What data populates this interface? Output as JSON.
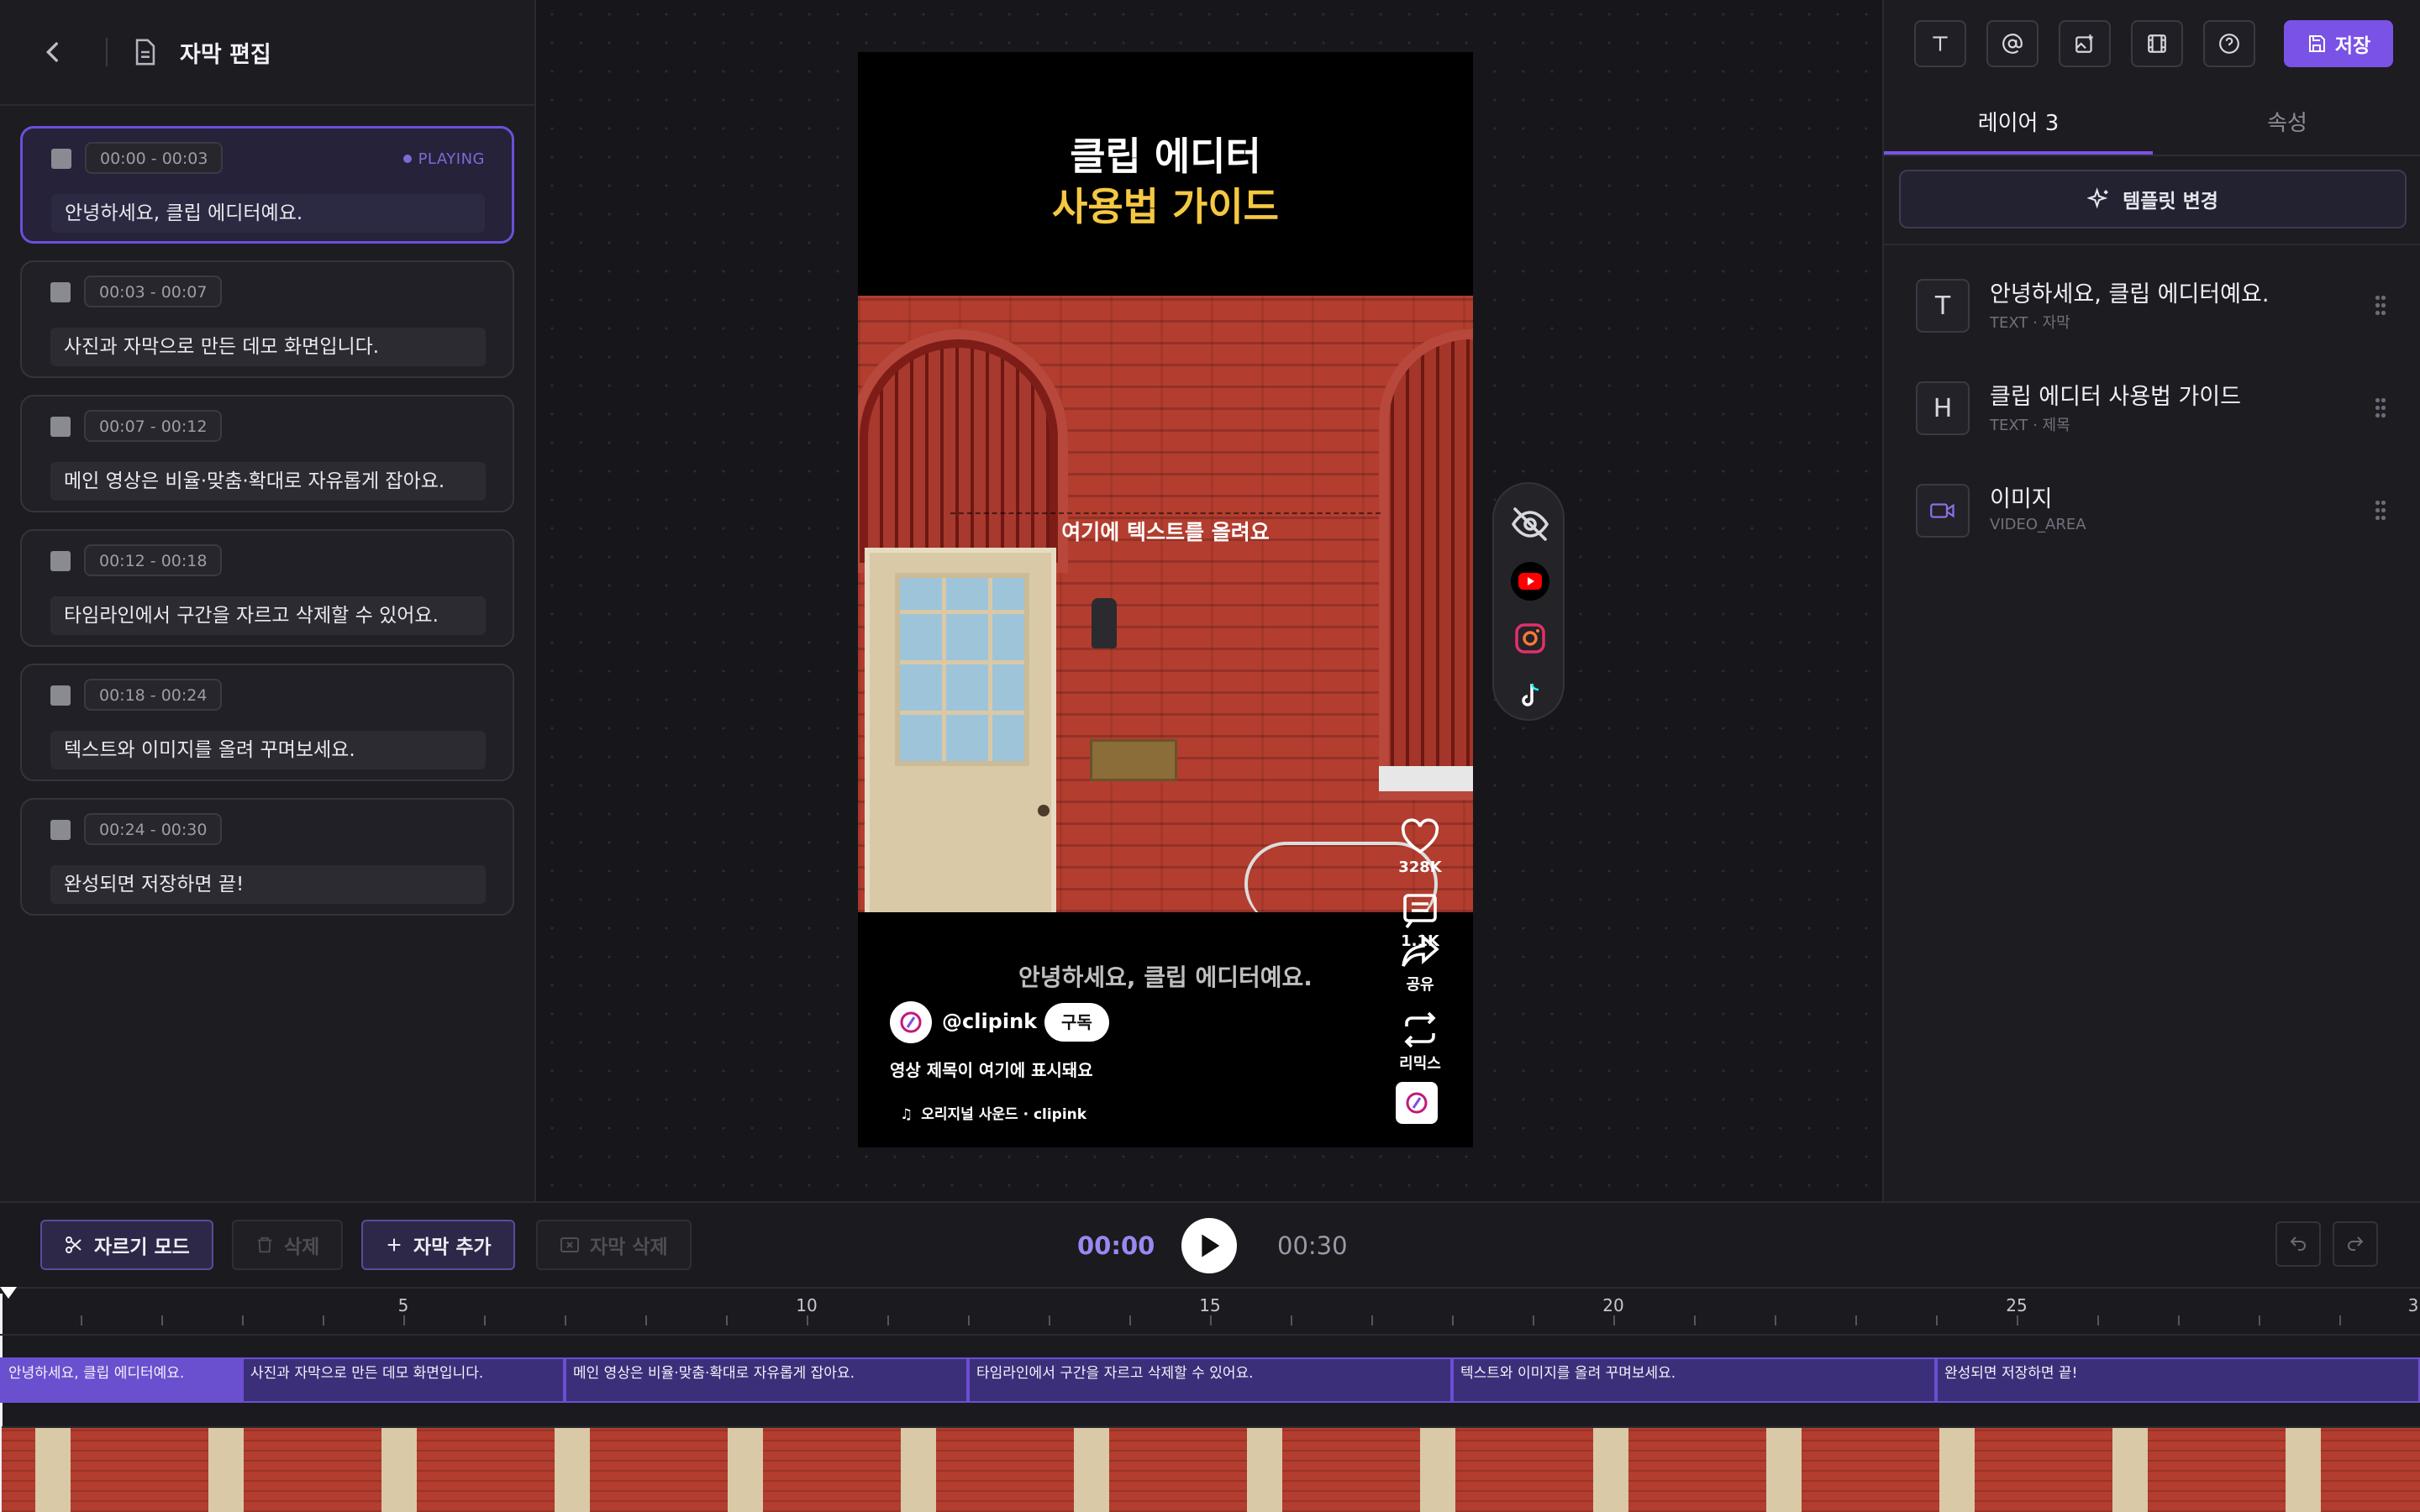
{
  "left_panel": {
    "title": "자막 편집",
    "cues": [
      {
        "time": "00:00 - 00:03",
        "text": "안녕하세요, 클립 에디터예요.",
        "status": "PLAYING"
      },
      {
        "time": "00:03 - 00:07",
        "text": "사진과 자막으로 만든 데모 화면입니다."
      },
      {
        "time": "00:07 - 00:12",
        "text": "메인 영상은 비율·맞춤·확대로 자유롭게 잡아요."
      },
      {
        "time": "00:12 - 00:18",
        "text": "타임라인에서 구간을 자르고 삭제할 수 있어요."
      },
      {
        "time": "00:18 - 00:24",
        "text": "텍스트와 이미지를 올려 꾸며보세요."
      },
      {
        "time": "00:24 - 00:30",
        "text": "완성되면 저장하면 끝!"
      }
    ]
  },
  "preview": {
    "title_line1": "클립 에디터",
    "title_line2": "사용법 가이드",
    "overlay_text": "여기에 텍스트를 올려요",
    "likes": "328K",
    "comments": "1.1K",
    "share_label": "공유",
    "remix_label": "리믹스",
    "caption": "안녕하세요, 클립 에디터예요.",
    "handle": "@clipink",
    "subscribe_label": "구독",
    "video_title": "영상 제목이 여기에 표시돼요",
    "music": "오리지널 사운드 · clipink"
  },
  "right_panel": {
    "save_label": "저장",
    "tabs": [
      "레이어 3",
      "속성"
    ],
    "template_button": "템플릿 변경",
    "layers": [
      {
        "icon": "T",
        "name": "안녕하세요, 클립 에디터예요.",
        "meta": "TEXT · 자막"
      },
      {
        "icon": "H",
        "name": "클립 에디터 사용법 가이드",
        "meta": "TEXT · 제목"
      },
      {
        "icon": "video-icon",
        "name": "이미지",
        "meta": "VIDEO_AREA"
      }
    ]
  },
  "bottom_bar": {
    "cut_mode": "자르기 모드",
    "delete": "삭제",
    "add_subtitle": "자막 추가",
    "delete_subtitle": "자막 삭제",
    "current_time": "00:00",
    "total_time": "00:30"
  },
  "timeline": {
    "ruler_labels": [
      "5",
      "10",
      "15",
      "20",
      "25",
      "3"
    ],
    "subtitle_segments": [
      {
        "text": "안녕하세요, 클립 에디터예요.",
        "start": 0,
        "end": 3
      },
      {
        "text": "사진과 자막으로 만든 데모 화면입니다.",
        "start": 3,
        "end": 7
      },
      {
        "text": "메인 영상은 비율·맞춤·확대로 자유롭게 잡아요.",
        "start": 7,
        "end": 12
      },
      {
        "text": "타임라인에서 구간을 자르고 삭제할 수 있어요.",
        "start": 12,
        "end": 18
      },
      {
        "text": "텍스트와 이미지를 올려 꾸며보세요.",
        "start": 18,
        "end": 24
      },
      {
        "text": "완성되면 저장하면 끝!",
        "start": 24,
        "end": 30
      }
    ]
  },
  "colors": {
    "accent": "#7b52e6",
    "title_yellow": "#f5c842"
  }
}
